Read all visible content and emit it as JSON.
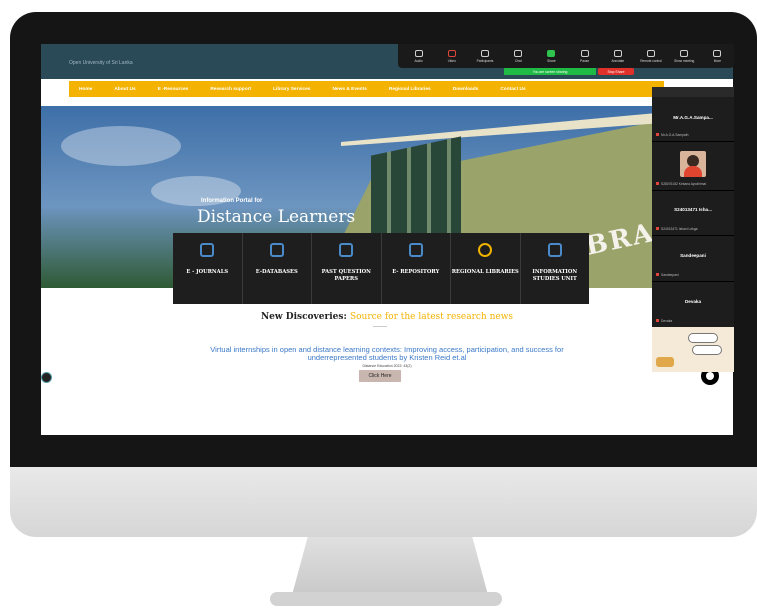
{
  "site": {
    "logo_alt": "Open University of Sri Lanka",
    "nav": [
      "Home",
      "About Us",
      "E -Resources",
      "Research support",
      "Library Services",
      "News & Events",
      "Regional Libraries",
      "Downloads",
      "Contact Us"
    ],
    "hero_subtitle": "Information Portal for",
    "hero_title": "Distance Learners",
    "library_sign": "LIBRAR",
    "tiles": [
      {
        "label": "E - JOURNALS",
        "icon": "journals-icon"
      },
      {
        "label": "E-DATABASES",
        "icon": "databases-icon"
      },
      {
        "label": "PAST QUESTION PAPERS",
        "icon": "papers-icon"
      },
      {
        "label": "E- REPOSITORY",
        "icon": "repository-icon"
      },
      {
        "label": "REGIONAL LIBRARIES",
        "icon": "regional-icon"
      },
      {
        "label": "INFORMATION STUDIES UNIT",
        "icon": "info-unit-icon"
      }
    ],
    "discoveries_label": "New Discoveries:",
    "discoveries_accent": "Source for the latest research news",
    "article_title": "Virtual internships in open and distance learning contexts: Improving access, participation, and success for underrepresented students by Kristen Reid et.al",
    "article_meta": "Distance Education 2022: 43(2)",
    "click_here": "Click Here"
  },
  "zoom": {
    "toolbar": [
      {
        "label": "Audio",
        "icon": "mic-icon",
        "state": "normal"
      },
      {
        "label": "Video",
        "icon": "camera-off-icon",
        "state": "off"
      },
      {
        "label": "Participants",
        "icon": "participants-icon",
        "state": "normal"
      },
      {
        "label": "Chat",
        "icon": "chat-icon",
        "state": "normal"
      },
      {
        "label": "Share",
        "icon": "share-icon",
        "state": "active"
      },
      {
        "label": "Pause",
        "icon": "pause-icon",
        "state": "normal"
      },
      {
        "label": "Annotate",
        "icon": "annotate-icon",
        "state": "normal"
      },
      {
        "label": "Remote control",
        "icon": "remote-icon",
        "state": "normal"
      },
      {
        "label": "Show meeting",
        "icon": "meeting-icon",
        "state": "normal"
      },
      {
        "label": "More",
        "icon": "more-icon",
        "state": "normal"
      }
    ],
    "share_status": "You are screen sharing",
    "stop_share": "Stop Share",
    "participants": [
      {
        "name": "Mr.A.G.A.Sampa...",
        "sub": "Mr.A.G.A.Sampath"
      },
      {
        "name": "",
        "sub": "S28076152 Kekana Ayodhimai"
      },
      {
        "name": "S24013471 Isha...",
        "sub": "S24013471 Ishani Lekga"
      },
      {
        "name": "Sandeepani",
        "sub": "Sandeepani"
      },
      {
        "name": "Devaka",
        "sub": "Devaka"
      }
    ]
  },
  "colors": {
    "nav_bg": "#f3b300",
    "header_bg": "#2a4a57",
    "accent": "#f3b300",
    "link": "#3a78c8",
    "share_green": "#1fba45",
    "stop_red": "#e0302a"
  }
}
